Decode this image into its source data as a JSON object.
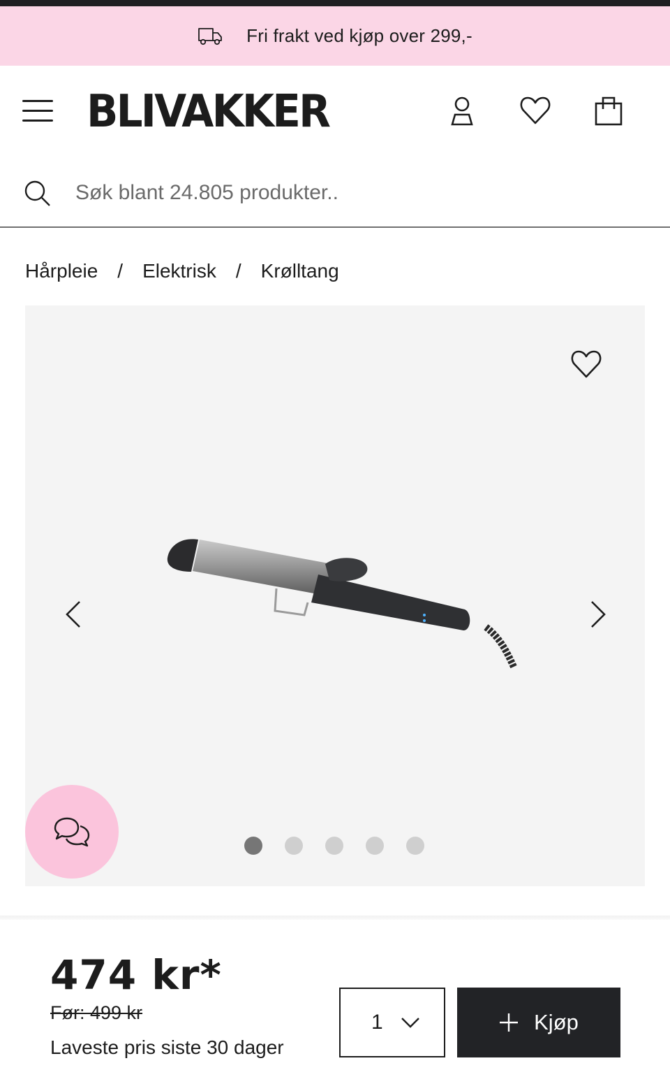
{
  "promo": {
    "text": "Fri frakt ved kjøp over 299,-",
    "icon": "truck-icon",
    "background": "#fbd6e6"
  },
  "header": {
    "logo": "BLIVAKKER",
    "icons": [
      "menu-icon",
      "user-icon",
      "heart-icon",
      "shopping-bag-icon"
    ]
  },
  "search": {
    "placeholder": "Søk blant 24.805 produkter.."
  },
  "breadcrumb": {
    "items": [
      "Hårpleie",
      "Elektrisk",
      "Krølltang"
    ],
    "separator": "/"
  },
  "gallery": {
    "image": "curling-iron-product",
    "slide_count": 5,
    "active_slide": 1,
    "background": "#f4f4f4"
  },
  "chat": {
    "icon": "chat-bubbles-icon",
    "background": "#fbc4dc"
  },
  "purchase": {
    "price": "474 kr*",
    "old_price": "Før: 499 kr",
    "lowest_price_note": "Laveste pris siste 30 dager",
    "quantity": "1",
    "buy_label": "Kjøp",
    "button_color": "#222326"
  }
}
